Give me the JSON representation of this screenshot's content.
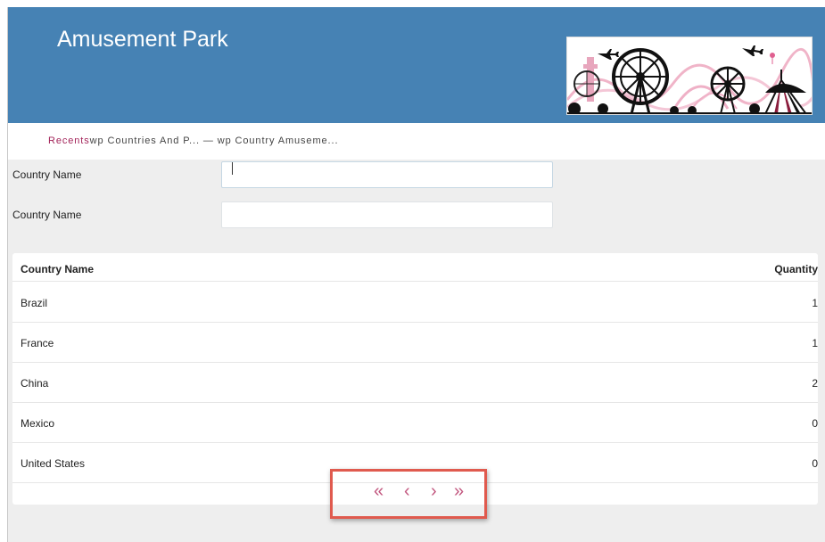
{
  "header": {
    "title": "Amusement Park",
    "banner_icon": "amusement-park-skyline-image",
    "background": "#4682b4"
  },
  "breadcrumb": {
    "recents": "Recents",
    "item1": "wp Countries And P...",
    "separator": " — ",
    "item2": "wp Country Amuseme..."
  },
  "form": {
    "field1_label": "Country Name",
    "field1_value": "",
    "field2_label": "Country Name",
    "field2_value": ""
  },
  "grid": {
    "columns": [
      "Country Name",
      "Quantity"
    ],
    "rows": [
      {
        "name": "Brazil",
        "qty": "1"
      },
      {
        "name": "France",
        "qty": "1"
      },
      {
        "name": "China",
        "qty": "2"
      },
      {
        "name": "Mexico",
        "qty": "0"
      },
      {
        "name": "United States",
        "qty": "0"
      }
    ]
  },
  "pager": {
    "first": "«",
    "prev": "‹",
    "next": "›",
    "last": "»",
    "color": "#c2577f",
    "highlight_color": "#e05a4e"
  }
}
